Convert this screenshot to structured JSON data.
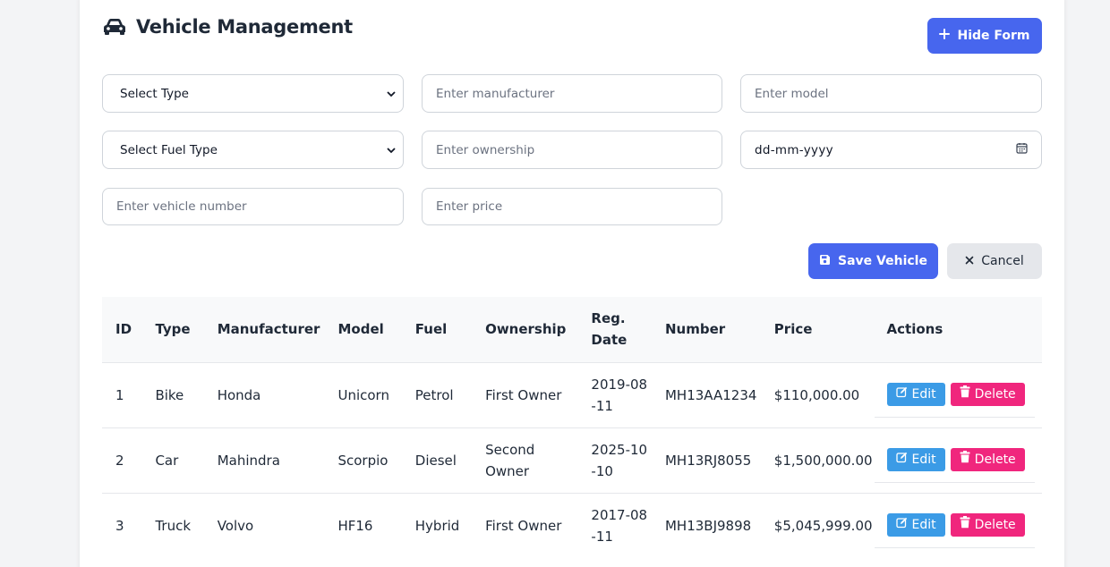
{
  "header": {
    "title": "Vehicle Management",
    "toggle_form_label": "Hide Form"
  },
  "form": {
    "type_select": "Select Type",
    "manufacturer_placeholder": "Enter manufacturer",
    "model_placeholder": "Enter model",
    "fuel_select": "Select Fuel Type",
    "ownership_placeholder": "Enter ownership",
    "date_placeholder": "dd-mm-yyyy",
    "number_placeholder": "Enter vehicle number",
    "price_placeholder": "Enter price",
    "save_label": "Save Vehicle",
    "cancel_label": "Cancel"
  },
  "table": {
    "headers": [
      "ID",
      "Type",
      "Manufacturer",
      "Model",
      "Fuel",
      "Ownership",
      "Reg. Date",
      "Number",
      "Price",
      "Actions"
    ],
    "rows": [
      {
        "id": "1",
        "type": "Bike",
        "manufacturer": "Honda",
        "model": "Unicorn",
        "fuel": "Petrol",
        "ownership": "First Owner",
        "reg_date": "2019-08-11",
        "number": "MH13AA1234",
        "price": "$110,000.00"
      },
      {
        "id": "2",
        "type": "Car",
        "manufacturer": "Mahindra",
        "model": "Scorpio",
        "fuel": "Diesel",
        "ownership": "Second Owner",
        "reg_date": "2025-10-10",
        "number": "MH13RJ8055",
        "price": "$1,500,000.00"
      },
      {
        "id": "3",
        "type": "Truck",
        "manufacturer": "Volvo",
        "model": "HF16",
        "fuel": "Hybrid",
        "ownership": "First Owner",
        "reg_date": "2017-08-11",
        "number": "MH13BJ9898",
        "price": "$5,045,999.00"
      }
    ],
    "edit_label": "Edit",
    "delete_label": "Delete"
  },
  "colors": {
    "primary": "#4766ee",
    "edit": "#3b9be6",
    "delete": "#f0267d"
  },
  "icons": {
    "title": "car-icon",
    "toggle": "plus-icon",
    "save": "floppy-disk-icon",
    "cancel": "close-icon",
    "date": "calendar-icon",
    "edit": "edit-icon",
    "delete": "trash-icon"
  }
}
